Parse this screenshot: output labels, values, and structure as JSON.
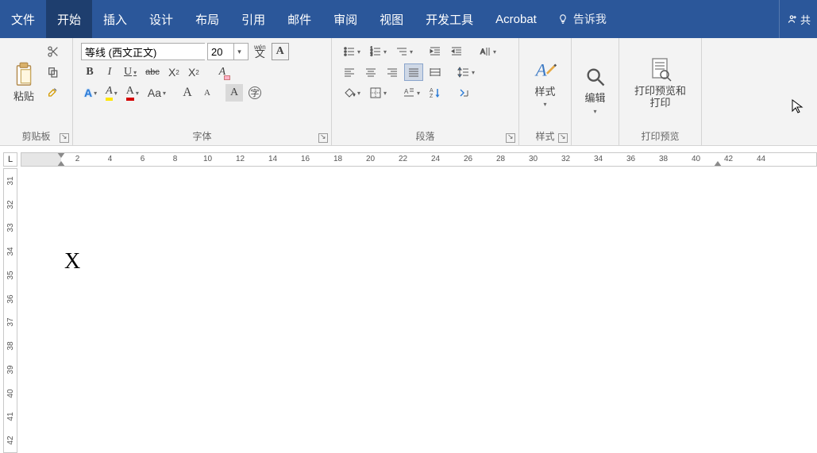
{
  "tabs": {
    "file": "文件",
    "home": "开始",
    "insert": "插入",
    "design": "设计",
    "layout": "布局",
    "references": "引用",
    "mailings": "邮件",
    "review": "审阅",
    "view": "视图",
    "developer": "开发工具",
    "acrobat": "Acrobat"
  },
  "tellme": "告诉我",
  "share": "共",
  "groups": {
    "clipboard": {
      "label": "剪贴板",
      "paste": "粘贴"
    },
    "font": {
      "label": "字体",
      "name": "等线 (西文正文)",
      "size": "20",
      "phonetic": "wén",
      "bold": "B",
      "italic": "I",
      "underline": "U",
      "strike": "abc",
      "sub": "X",
      "sup": "X",
      "Aa": "Aa",
      "grow": "A",
      "shrink": "A",
      "clear": "A",
      "charborder": "A",
      "effects": "A",
      "highlight": "A",
      "fontcolor": "A"
    },
    "paragraph": {
      "label": "段落"
    },
    "styles": {
      "label": "样式",
      "btn": "样式"
    },
    "editing": {
      "label": "",
      "btn": "编辑"
    },
    "printpreview": {
      "label": "打印预览",
      "btn": "打印预览和打印"
    }
  },
  "ruler_h": [
    "2",
    "4",
    "6",
    "8",
    "10",
    "12",
    "14",
    "16",
    "18",
    "20",
    "22",
    "24",
    "26",
    "28",
    "30",
    "32",
    "34",
    "36",
    "38",
    "40",
    "42",
    "44"
  ],
  "ruler_v": [
    "31",
    "32",
    "33",
    "34",
    "35",
    "36",
    "37",
    "38",
    "39",
    "40",
    "41",
    "42"
  ],
  "document_text": "X",
  "tab_selector": "L"
}
